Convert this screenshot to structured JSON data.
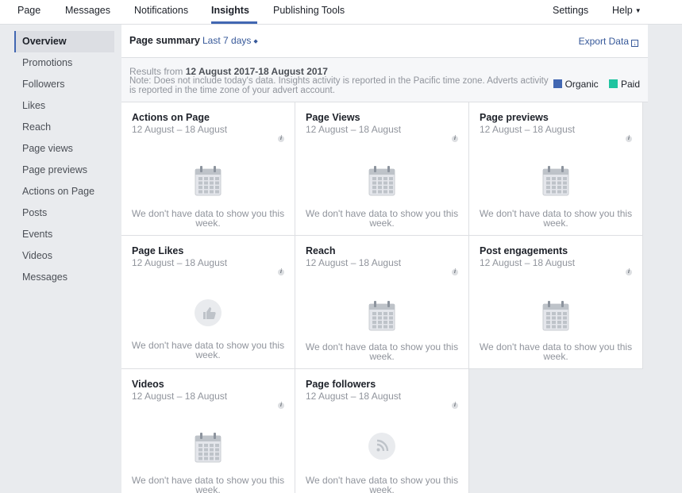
{
  "topnav": {
    "items": [
      "Page",
      "Messages",
      "Notifications",
      "Insights",
      "Publishing Tools"
    ],
    "settings": "Settings",
    "help": "Help"
  },
  "sidebar": {
    "items": [
      "Overview",
      "Promotions",
      "Followers",
      "Likes",
      "Reach",
      "Page views",
      "Page previews",
      "Actions on Page",
      "Posts",
      "Events",
      "Videos",
      "Messages"
    ]
  },
  "summary": {
    "title": "Page summary",
    "range": "Last 7 days",
    "export": "Export Data"
  },
  "info": {
    "results_prefix": "Results from",
    "results_range": "12 August 2017-18 August 2017",
    "note": "Note: Does not include today's data. Insights activity is reported in the Pacific time zone. Adverts activity is reported in the time zone of your advert account.",
    "legend": [
      {
        "label": "Organic",
        "color": "#4267b2"
      },
      {
        "label": "Paid",
        "color": "#20c4a0"
      }
    ]
  },
  "cards": [
    {
      "title": "Actions on Page",
      "date": "12 August – 18 August",
      "icon": "calendar-icon",
      "message": "We don't have data to show you this week."
    },
    {
      "title": "Page Views",
      "date": "12 August – 18 August",
      "icon": "calendar-icon",
      "message": "We don't have data to show you this week."
    },
    {
      "title": "Page previews",
      "date": "12 August – 18 August",
      "icon": "calendar-icon",
      "message": "We don't have data to show you this week."
    },
    {
      "title": "Page Likes",
      "date": "12 August – 18 August",
      "icon": "thumbs-up-icon",
      "message": "We don't have data to show you this week."
    },
    {
      "title": "Reach",
      "date": "12 August – 18 August",
      "icon": "calendar-icon",
      "message": "We don't have data to show you this week."
    },
    {
      "title": "Post engagements",
      "date": "12 August – 18 August",
      "icon": "calendar-icon",
      "message": "We don't have data to show you this week."
    },
    {
      "title": "Videos",
      "date": "12 August – 18 August",
      "icon": "calendar-icon",
      "message": "We don't have data to show you this week."
    },
    {
      "title": "Page followers",
      "date": "12 August – 18 August",
      "icon": "rss-icon",
      "message": "We don't have data to show you this week."
    }
  ]
}
